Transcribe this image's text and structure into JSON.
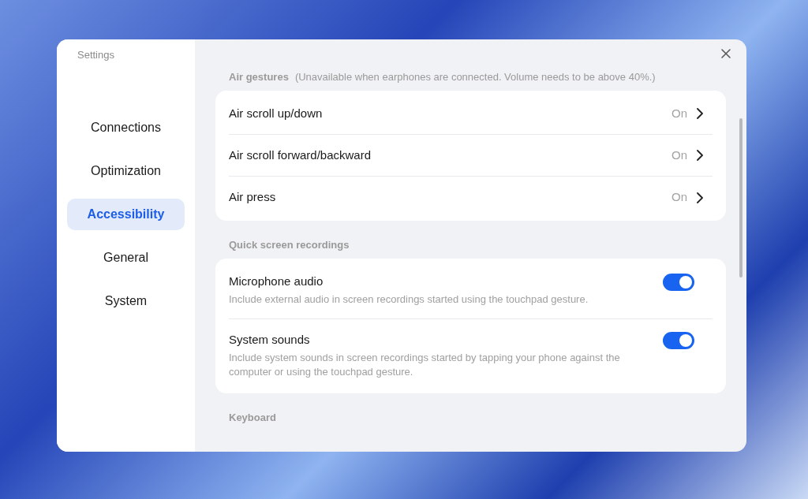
{
  "window": {
    "title": "Settings"
  },
  "sidebar": {
    "items": [
      {
        "label": "Connections",
        "selected": false
      },
      {
        "label": "Optimization",
        "selected": false
      },
      {
        "label": "Accessibility",
        "selected": true
      },
      {
        "label": "General",
        "selected": false
      },
      {
        "label": "System",
        "selected": false
      }
    ]
  },
  "sections": [
    {
      "title": "Air gestures",
      "note": "(Unavailable when earphones are connected. Volume needs to be above 40%.)",
      "rows": [
        {
          "kind": "nav",
          "label": "Air scroll up/down",
          "value": "On"
        },
        {
          "kind": "nav",
          "label": "Air scroll forward/backward",
          "value": "On"
        },
        {
          "kind": "nav",
          "label": "Air press",
          "value": "On"
        }
      ]
    },
    {
      "title": "Quick screen recordings",
      "rows": [
        {
          "kind": "toggle",
          "label": "Microphone audio",
          "description": "Include external audio in screen recordings started using the touchpad gesture.",
          "on": true
        },
        {
          "kind": "toggle",
          "label": "System sounds",
          "description": "Include system sounds in screen recordings started by tapping your phone against the computer or using the touchpad gesture.",
          "on": true
        }
      ]
    },
    {
      "title": "Keyboard"
    }
  ]
}
